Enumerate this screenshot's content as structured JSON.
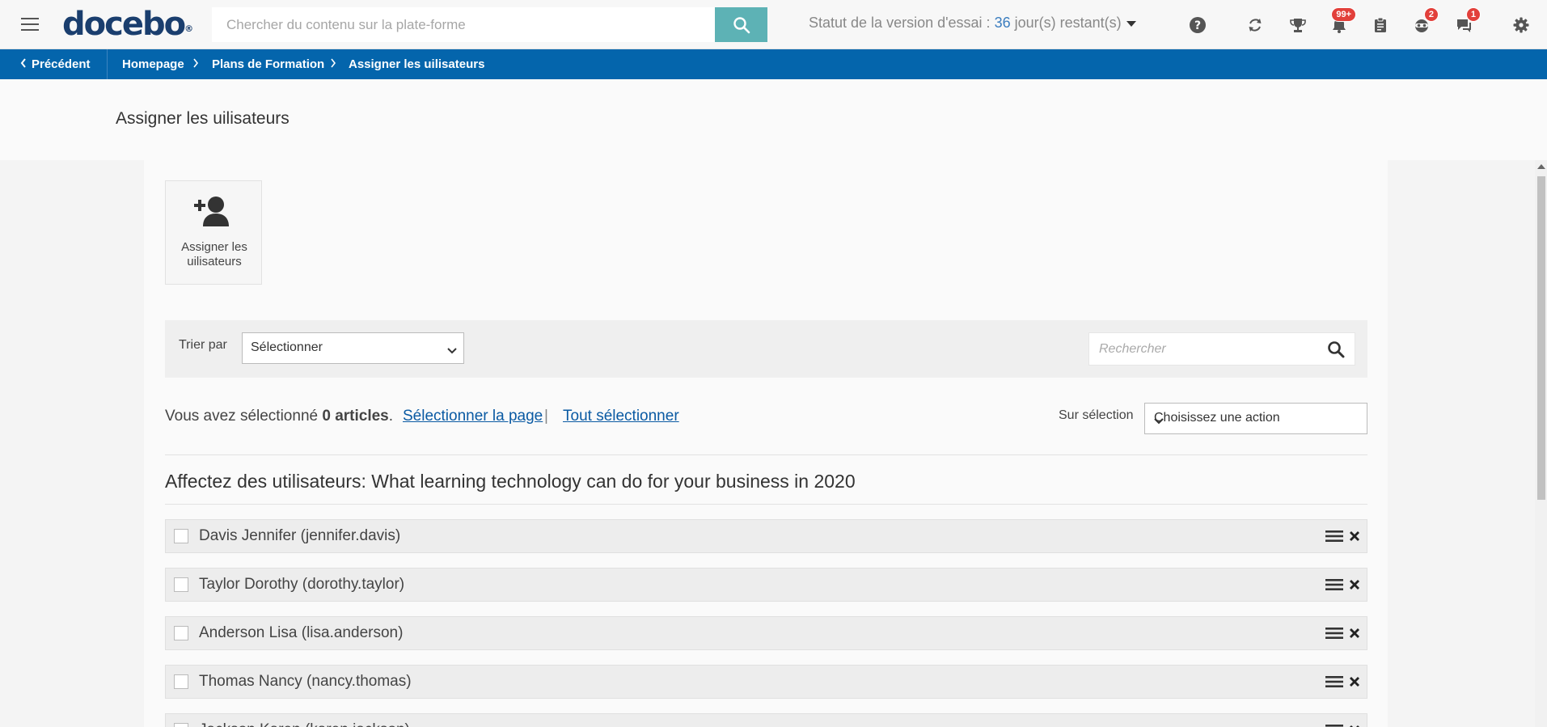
{
  "topbar": {
    "logo": "docebo",
    "logo_mark": "®",
    "search_placeholder": "Chercher du contenu sur la plate-forme",
    "trial_label": "Statut de la version d'essai :",
    "trial_days": "36",
    "trial_suffix": "jour(s) restant(s)",
    "badges": {
      "notifications": "99+",
      "gamification": "2",
      "messages": "1"
    }
  },
  "breadcrumb": {
    "back": "Précédent",
    "items": [
      "Homepage",
      "Plans de Formation",
      "Assigner les uilisateurs"
    ]
  },
  "page": {
    "title": "Assigner les uilisateurs"
  },
  "assign_tile": {
    "label_line1": "Assigner les",
    "label_line2": "uilisateurs"
  },
  "filter": {
    "sort_label": "Trier par",
    "sort_value": "Sélectionner",
    "search_placeholder": "Rechercher"
  },
  "selection": {
    "prefix": "Vous avez sélectionné",
    "count": "0 articles",
    "period": ".",
    "select_page": "Sélectionner la page",
    "separator": "|",
    "select_all": "Tout sélectionner",
    "on_selection_label": "Sur sélection",
    "action_value": "Choisissez une action"
  },
  "section": {
    "title": "Affectez des utilisateurs: What learning technology can do for your business in 2020"
  },
  "users": [
    "Davis Jennifer (jennifer.davis)",
    "Taylor Dorothy (dorothy.taylor)",
    "Anderson Lisa (lisa.anderson)",
    "Thomas Nancy (nancy.thomas)",
    "Jackson Karen (karen.jackson)"
  ],
  "colors": {
    "brand_blue": "#0465ac",
    "search_button": "#5db2b5",
    "badge_red": "#e2403b",
    "link": "#0a5aa3"
  }
}
